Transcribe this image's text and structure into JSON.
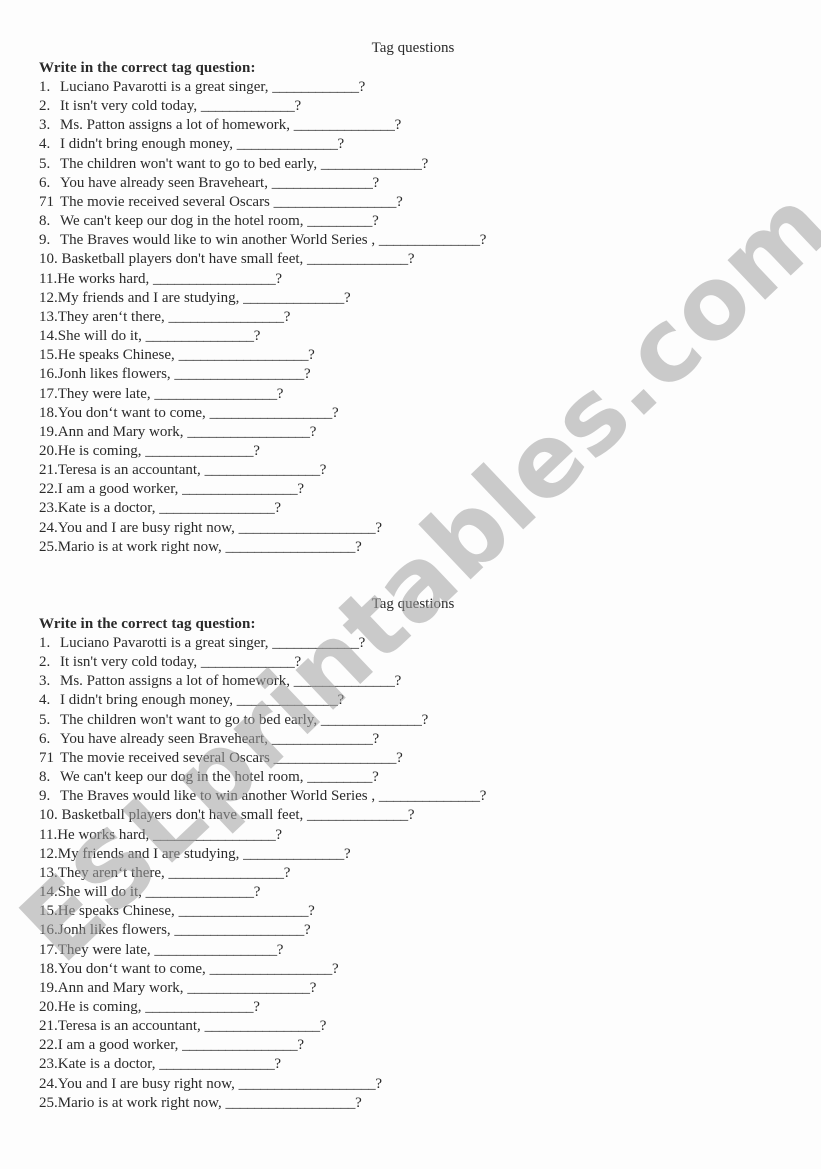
{
  "watermark": "ESLprintables.com",
  "sections": [
    {
      "title": "Tag questions",
      "heading": "Write in the correct tag question:",
      "items": [
        {
          "num": "1.",
          "text": "Luciano Pavarotti is a great singer, ",
          "blank": 12
        },
        {
          "num": "2.",
          "text": "It isn't very cold today, ",
          "blank": 13
        },
        {
          "num": "3.",
          "text": "Ms. Patton assigns a lot of homework, ",
          "blank": 14
        },
        {
          "num": "4.",
          "text": "I didn't bring enough money, ",
          "blank": 14
        },
        {
          "num": "5.",
          "text": "The children won't want to go to bed early, ",
          "blank": 14
        },
        {
          "num": "6.",
          "text": "You have already seen Braveheart, ",
          "blank": 14
        },
        {
          "num": "71",
          "text": "The movie received several Oscars ",
          "blank": 17
        },
        {
          "num": "8.",
          "text": "We can't keep our dog in the hotel room, ",
          "blank": 9
        },
        {
          "num": "9.",
          "text": "The Braves would like to win another World Series , ",
          "blank": 14
        },
        {
          "num": "10.",
          "text": "Basketball players don't have small feet, ",
          "blank": 14
        },
        {
          "num": "11.",
          "text": "He works hard, ",
          "blank": 17
        },
        {
          "num": "12.",
          "text": "My friends and I are studying, ",
          "blank": 14
        },
        {
          "num": "13.",
          "text": "They aren‘t there, ",
          "blank": 16
        },
        {
          "num": "14.",
          "text": "She will do it, ",
          "blank": 15
        },
        {
          "num": "15.",
          "text": "He speaks Chinese, ",
          "blank": 18
        },
        {
          "num": "16.",
          "text": "Jonh likes flowers, ",
          "blank": 18
        },
        {
          "num": "17.",
          "text": "They were late, ",
          "blank": 17
        },
        {
          "num": "18.",
          "text": "You don‘t want to come, ",
          "blank": 17
        },
        {
          "num": "19.",
          "text": "Ann and Mary work, ",
          "blank": 17
        },
        {
          "num": "20.",
          "text": "He is coming, ",
          "blank": 15
        },
        {
          "num": "21.",
          "text": "Teresa is an accountant, ",
          "blank": 16
        },
        {
          "num": "22.",
          "text": "I am a good worker, ",
          "blank": 16
        },
        {
          "num": "23.",
          "text": "Kate is a doctor, ",
          "blank": 16
        },
        {
          "num": "24.",
          "text": "You and I are busy right now, ",
          "blank": 19
        },
        {
          "num": "25.",
          "text": "Mario is at work right now, ",
          "blank": 18
        }
      ]
    },
    {
      "title": "Tag questions",
      "heading": "Write in the correct tag question:",
      "items": [
        {
          "num": "1.",
          "text": "Luciano Pavarotti is a great singer, ",
          "blank": 12
        },
        {
          "num": "2.",
          "text": "It isn't very cold today, ",
          "blank": 13
        },
        {
          "num": "3.",
          "text": "Ms. Patton assigns a lot of homework, ",
          "blank": 14
        },
        {
          "num": "4.",
          "text": "I didn't bring enough money, ",
          "blank": 14
        },
        {
          "num": "5.",
          "text": "The children won't want to go to bed early, ",
          "blank": 14
        },
        {
          "num": "6.",
          "text": "You have already seen Braveheart, ",
          "blank": 14
        },
        {
          "num": "71",
          "text": "The movie received several Oscars ",
          "blank": 17
        },
        {
          "num": "8.",
          "text": "We can't keep our dog in the hotel room, ",
          "blank": 9
        },
        {
          "num": "9.",
          "text": "The Braves would like to win another World Series , ",
          "blank": 14
        },
        {
          "num": "10.",
          "text": "Basketball players don't have small feet, ",
          "blank": 14
        },
        {
          "num": "11.",
          "text": "He works hard, ",
          "blank": 17
        },
        {
          "num": "12.",
          "text": "My friends and I are studying, ",
          "blank": 14
        },
        {
          "num": "13.",
          "text": "They aren‘t there, ",
          "blank": 16
        },
        {
          "num": "14.",
          "text": "She will do it, ",
          "blank": 15
        },
        {
          "num": "15.",
          "text": "He speaks Chinese, ",
          "blank": 18
        },
        {
          "num": "16.",
          "text": "Jonh likes flowers, ",
          "blank": 18
        },
        {
          "num": "17.",
          "text": "They were late, ",
          "blank": 17
        },
        {
          "num": "18.",
          "text": "You don‘t want to come, ",
          "blank": 17
        },
        {
          "num": "19.",
          "text": "Ann and Mary work, ",
          "blank": 17
        },
        {
          "num": "20.",
          "text": "He is coming, ",
          "blank": 15
        },
        {
          "num": "21.",
          "text": "Teresa is an accountant, ",
          "blank": 16
        },
        {
          "num": "22.",
          "text": "I am a good worker, ",
          "blank": 16
        },
        {
          "num": "23.",
          "text": "Kate is a doctor, ",
          "blank": 16
        },
        {
          "num": "24.",
          "text": "You and I are busy right now, ",
          "blank": 19
        },
        {
          "num": "25.",
          "text": "Mario is at work right now, ",
          "blank": 18
        }
      ]
    }
  ]
}
